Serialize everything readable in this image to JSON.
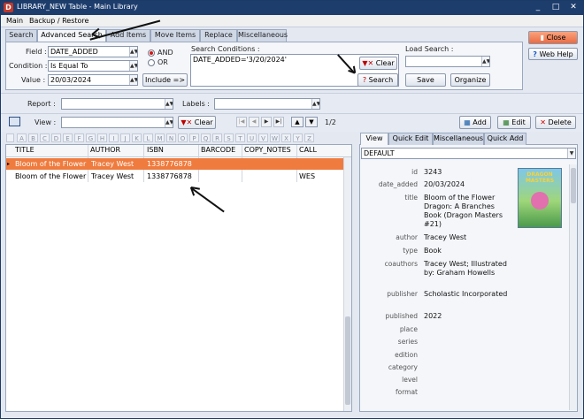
{
  "window": {
    "title": "LIBRARY_NEW Table - Main Library",
    "app_icon_letter": "D",
    "minimize": "_",
    "maximize": "□",
    "close": "✕"
  },
  "menu": {
    "items": [
      "Main",
      "Backup / Restore"
    ]
  },
  "tabs": [
    "Search",
    "Advanced Search",
    "Add Items",
    "Move Items",
    "Replace",
    "Miscellaneous"
  ],
  "search": {
    "field_label": "Field :",
    "field_value": "DATE_ADDED",
    "condition_label": "Condition :",
    "condition_value": "Is Equal To",
    "value_label": "Value :",
    "value_value": "20/03/2024",
    "and_label": "AND",
    "or_label": "OR",
    "include_label": "Include =>",
    "conditions_label": "Search Conditions :",
    "conditions_text": "DATE_ADDED='3/20/2024'",
    "clear_label": "Clear",
    "search_label": "Search",
    "load_search_label": "Load Search :",
    "save_label": "Save",
    "organize_label": "Organize"
  },
  "right_buttons": {
    "close_label": "Close",
    "webhelp_label": "Web Help"
  },
  "filters": {
    "report_label": "Report :",
    "labels_label": "Labels :"
  },
  "view_bar": {
    "view_label": "View :",
    "clear_label": "Clear",
    "page_indicator": "1/2",
    "add_label": "Add",
    "edit_label": "Edit",
    "delete_label": "Delete"
  },
  "alphabet": [
    "A",
    "B",
    "C",
    "D",
    "E",
    "F",
    "G",
    "H",
    "I",
    "J",
    "K",
    "L",
    "M",
    "N",
    "O",
    "P",
    "Q",
    "R",
    "S",
    "T",
    "U",
    "V",
    "W",
    "X",
    "Y",
    "Z"
  ],
  "grid": {
    "columns": [
      "TITLE",
      "AUTHOR",
      "ISBN",
      "BARCODE",
      "COPY_NOTES",
      "CALL"
    ],
    "rows": [
      [
        "Bloom of the Flower I",
        "Tracey West",
        "1338776878",
        "",
        "",
        ""
      ],
      [
        "Bloom of the Flower I",
        "Tracey West",
        "1338776878",
        "",
        "",
        "WES"
      ]
    ]
  },
  "detail": {
    "tabs": [
      "View",
      "Quick Edit",
      "Miscellaneous",
      "Quick Add"
    ],
    "layout_value": "DEFAULT",
    "cover_title": "DRAGON MASTERS",
    "fields": [
      {
        "label": "id",
        "value": "3243"
      },
      {
        "label": "date_added",
        "value": "20/03/2024"
      },
      {
        "label": "title",
        "value": "Bloom of the Flower Dragon: A Branches Book (Dragon Masters #21)"
      },
      {
        "label": "author",
        "value": "Tracey West"
      },
      {
        "label": "type",
        "value": "Book"
      },
      {
        "label": "coauthors",
        "value": "Tracey West; Illustrated by: Graham Howells"
      },
      {
        "label": "publisher",
        "value": "Scholastic Incorporated"
      },
      {
        "label": "published",
        "value": "2022"
      },
      {
        "label": "place",
        "value": ""
      },
      {
        "label": "series",
        "value": ""
      },
      {
        "label": "edition",
        "value": ""
      },
      {
        "label": "category",
        "value": ""
      },
      {
        "label": "level",
        "value": ""
      },
      {
        "label": "format",
        "value": ""
      }
    ]
  },
  "colors": {
    "accent_orange": "#ef7b3e",
    "title_bar": "#1d3d6d",
    "close_red": "#f08060"
  }
}
